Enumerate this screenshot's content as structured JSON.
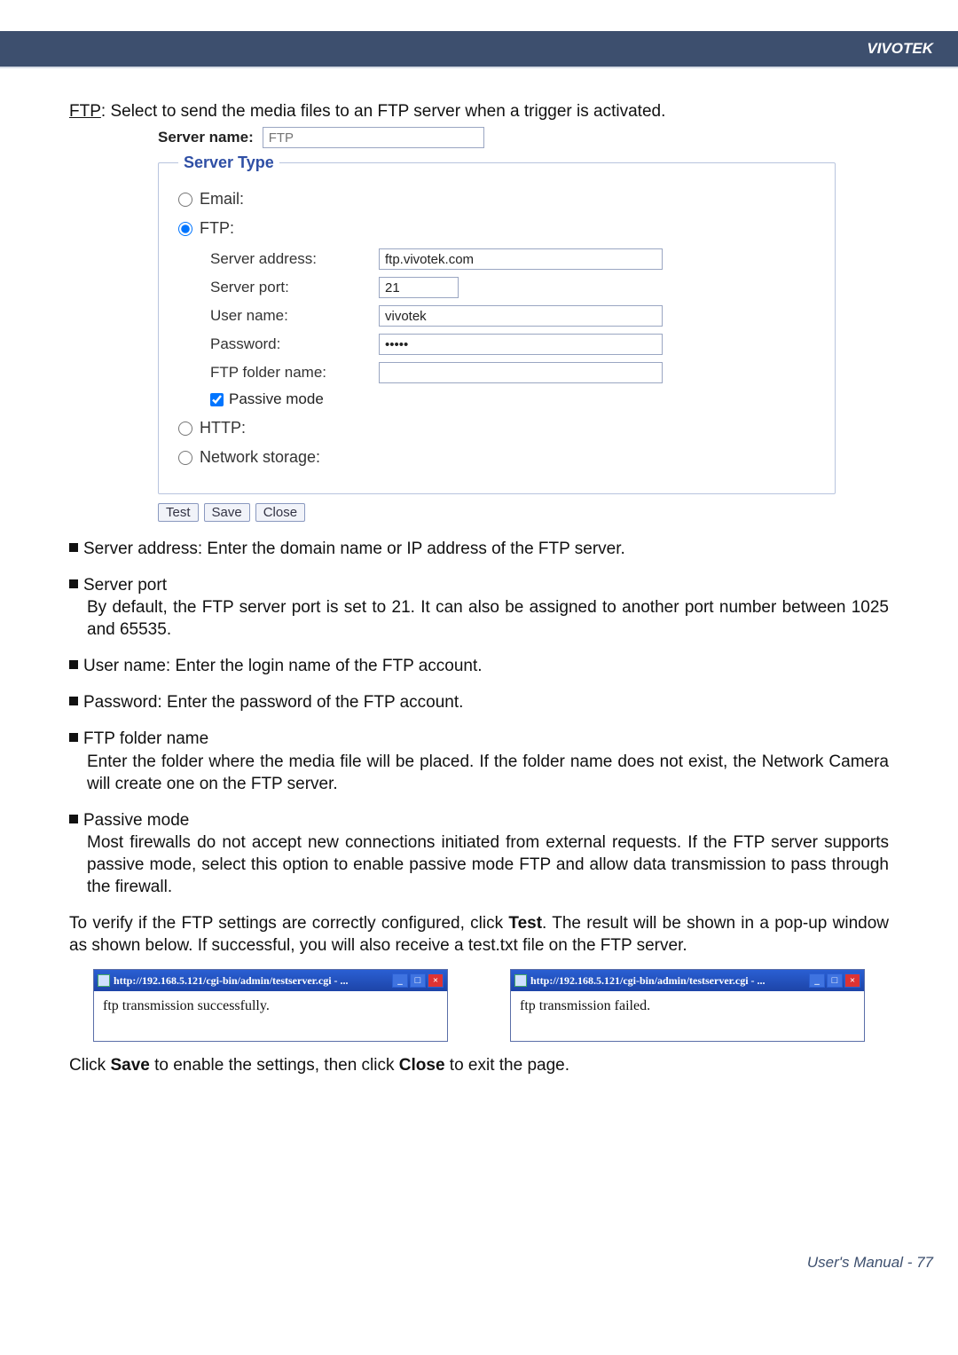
{
  "header": {
    "brand": "VIVOTEK"
  },
  "intro": {
    "prefix": "FTP",
    "text": ": Select to send the media files to an FTP server when a trigger is activated."
  },
  "form": {
    "server_name_label": "Server name:",
    "server_name_placeholder": "FTP",
    "fieldset_legend": "Server Type",
    "radios": {
      "email": "Email:",
      "ftp": "FTP:",
      "http": "HTTP:",
      "network_storage": "Network storage:"
    },
    "ftp_fields": {
      "server_address_label": "Server address:",
      "server_address_value": "ftp.vivotek.com",
      "server_port_label": "Server port:",
      "server_port_value": "21",
      "user_name_label": "User name:",
      "user_name_value": "vivotek",
      "password_label": "Password:",
      "password_value": "•••••",
      "folder_label": "FTP folder name:",
      "folder_value": "",
      "passive_label": "Passive mode"
    },
    "buttons": {
      "test": "Test",
      "save": "Save",
      "close": "Close"
    }
  },
  "bullets": {
    "server_address": "Server address: Enter the domain name or IP address of the FTP server.",
    "server_port_title": "Server port",
    "server_port_body": "By default, the FTP server port is set to 21. It can also be assigned to another port number between 1025 and 65535.",
    "user_name": "User name: Enter the login name of the FTP account.",
    "password": "Password: Enter the password of the FTP account.",
    "folder_title": "FTP folder name",
    "folder_body": "Enter the folder where the media file will be placed. If the folder name does not exist, the Network Camera will create one on the FTP server.",
    "passive_title": "Passive mode",
    "passive_body": "Most firewalls do not accept new connections initiated from external requests. If the FTP server supports passive mode, select this option to enable passive mode FTP and allow data transmission to pass through the firewall."
  },
  "verify": {
    "p1_a": "To verify if the FTP settings are correctly configured, click ",
    "p1_bold": "Test",
    "p1_b": ". The result will be shown in a pop-up window as shown below. If successful, you will also receive a test.txt file on the FTP server."
  },
  "popups": {
    "title": "http://192.168.5.121/cgi-bin/admin/testserver.cgi - ...",
    "success": "ftp transmission successfully.",
    "failed": "ftp transmission failed."
  },
  "closing": {
    "a": "Click ",
    "b1": "Save",
    "c": " to enable the settings, then click ",
    "b2": "Close",
    "d": " to exit the page."
  },
  "footer": {
    "text": "User's Manual - 77"
  }
}
